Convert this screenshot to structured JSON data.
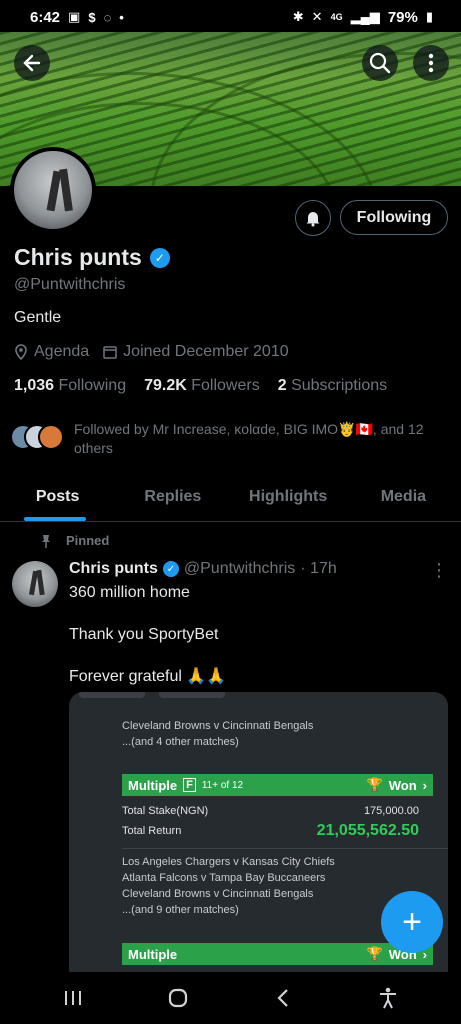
{
  "status_bar": {
    "time": "6:42",
    "battery": "79%",
    "network": "4G"
  },
  "header": {
    "back_icon": "arrow-left-icon",
    "search_icon": "search-icon",
    "more_icon": "more-vertical-icon"
  },
  "profile": {
    "name": "Chris punts",
    "handle": "@Puntwithchris",
    "bio": "Gentle",
    "location": "Agenda",
    "joined": "Joined December 2010",
    "following_count": "1,036",
    "following_label": "Following",
    "followers_count": "79.2K",
    "followers_label": "Followers",
    "subscriptions_count": "2",
    "subscriptions_label": "Subscriptions",
    "follow_button": "Following",
    "followed_by": "Followed by Mr Increase, κolαde, BIG IMO🤴🇨🇦, and 12 others",
    "verified_color": "#1d9bf0"
  },
  "tabs": [
    {
      "label": "Posts",
      "active": true
    },
    {
      "label": "Replies",
      "active": false
    },
    {
      "label": "Highlights",
      "active": false
    },
    {
      "label": "Media",
      "active": false
    }
  ],
  "post": {
    "pinned_label": "Pinned",
    "author": "Chris punts",
    "handle": "@Puntwithchris",
    "time": "· 17h",
    "lines": [
      "360 million home",
      "Thank you SportyBet",
      "Forever grateful 🙏🙏"
    ]
  },
  "bet_slip": {
    "matches_1": [
      "Cleveland Browns v Cincinnati Bengals",
      "...(and 4 other matches)"
    ],
    "multiple_label": "Multiple",
    "multiple_sub": "11+ of 12",
    "won_label": "Won",
    "total_stake_label": "Total Stake(NGN)",
    "total_stake": "175,000.00",
    "total_return_label": "Total Return",
    "total_return": "21,055,562.50",
    "matches_2": [
      "Los Angeles Chargers v Kansas City Chiefs",
      "Atlanta Falcons v Tampa Bay Buccaneers",
      "Cleveland Browns v Cincinnati Bengals",
      "...(and 9 other matches)"
    ],
    "multiple_label_2": "Multiple",
    "won_label_2": "Won",
    "accent_color": "#2ba24a"
  },
  "fab_label": "+",
  "nav": {
    "recent_icon": "recent-apps-icon",
    "home_icon": "home-icon",
    "back_icon": "back-icon",
    "accessibility_icon": "accessibility-icon"
  }
}
